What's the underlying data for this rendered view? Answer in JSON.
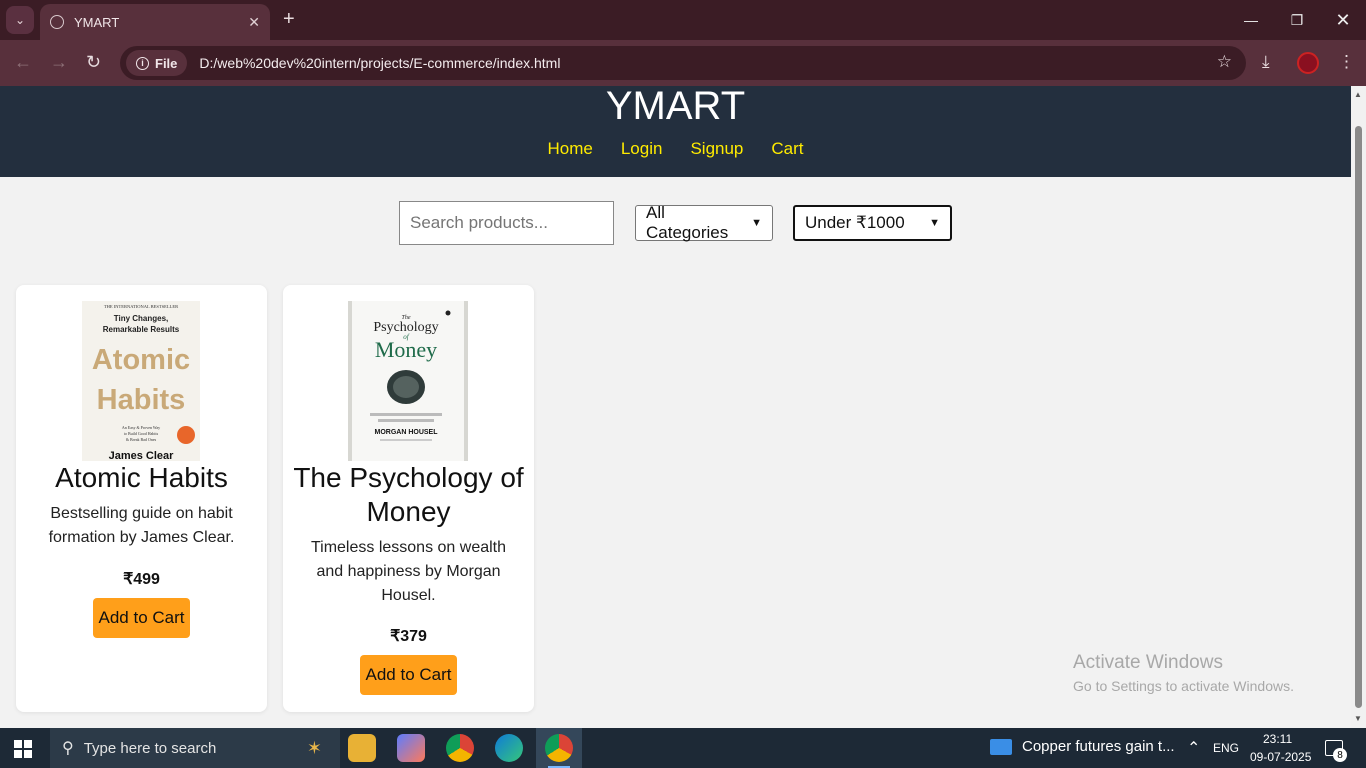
{
  "browser": {
    "tab_title": "YMART",
    "tab_close": "✕",
    "new_tab": "+",
    "file_chip": "File",
    "url": "D:/web%20dev%20intern/projects/E-commerce/index.html"
  },
  "site": {
    "title": "YMART",
    "nav": [
      "Home",
      "Login",
      "Signup",
      "Cart"
    ]
  },
  "filters": {
    "search_placeholder": "Search products...",
    "category": "All Categories",
    "price": "Under ₹1000"
  },
  "products": [
    {
      "title": "Atomic Habits",
      "description": "Bestselling guide on habit formation by James Clear.",
      "price": "₹499",
      "button": "Add to Cart",
      "cover": {
        "top_note": "THE INTERNATIONAL BESTSELLER",
        "subtitle": "Tiny Changes, Remarkable Results",
        "title_line1": "Atomic",
        "title_line2": "Habits",
        "tagline": "An Easy & Proven Way to Build Good Habits & Break Bad Ones",
        "author": "James Clear"
      }
    },
    {
      "title": "The Psychology of Money",
      "description": "Timeless lessons on wealth and happiness by Morgan Housel.",
      "price": "₹379",
      "button": "Add to Cart",
      "cover": {
        "title_line1": "Psychology",
        "title_line2": "Money",
        "small": "The",
        "of": "of",
        "author": "MORGAN HOUSEL"
      }
    }
  ],
  "watermark": {
    "line1": "Activate Windows",
    "line2": "Go to Settings to activate Windows."
  },
  "taskbar": {
    "search_placeholder": "Type here to search",
    "news": "Copper futures gain t...",
    "lang": "ENG",
    "time": "23:11",
    "date": "09-07-2025",
    "notifications": "8"
  }
}
